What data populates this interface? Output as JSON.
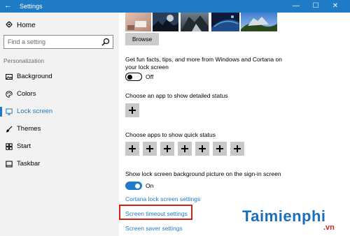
{
  "window": {
    "title": "Settings",
    "back_glyph": "←",
    "controls": {
      "minimize": "—",
      "maximize": "☐",
      "close": "✕"
    }
  },
  "sidebar": {
    "home_label": "Home",
    "search_placeholder": "Find a setting",
    "section_label": "Personalization",
    "items": [
      {
        "label": "Background",
        "icon": "picture-icon",
        "active": false
      },
      {
        "label": "Colors",
        "icon": "palette-icon",
        "active": false
      },
      {
        "label": "Lock screen",
        "icon": "lock-screen-icon",
        "active": true
      },
      {
        "label": "Themes",
        "icon": "brush-icon",
        "active": false
      },
      {
        "label": "Start",
        "icon": "start-icon",
        "active": false
      },
      {
        "label": "Taskbar",
        "icon": "taskbar-icon",
        "active": false
      }
    ]
  },
  "main": {
    "browse_label": "Browse",
    "fun_facts_desc": "Get fun facts, tips, and more from Windows and Cortana on your lock screen",
    "fun_facts_state": "Off",
    "detailed_status_label": "Choose an app to show detailed status",
    "quick_status_label": "Choose apps to show quick status",
    "signin_bg_label": "Show lock screen background picture on the sign-in screen",
    "signin_bg_state": "On",
    "links": {
      "cortana": "Cortana lock screen settings",
      "timeout": "Screen timeout settings",
      "saver": "Screen saver settings"
    }
  },
  "watermark": {
    "brand": "Taimienphi",
    "domain": ".vn"
  },
  "colors": {
    "accent": "#1f7bc5",
    "highlight": "#d0211c",
    "sidebar_bg": "#f2f2f2"
  }
}
